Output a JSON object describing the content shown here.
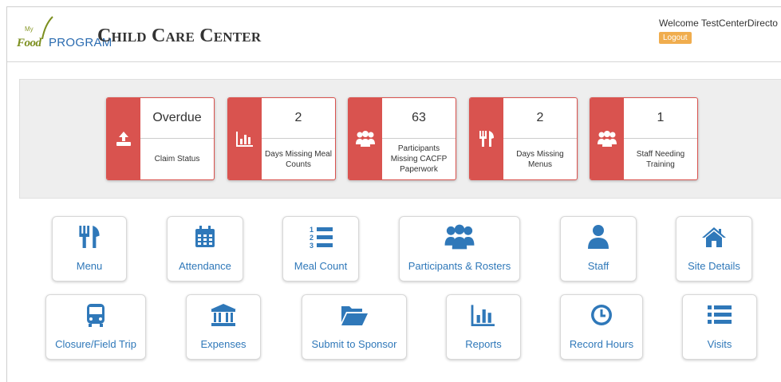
{
  "header": {
    "logo_my": "My",
    "logo_food": "Food",
    "logo_program": "PROGRAM",
    "title": "Child Care Center",
    "welcome": "Welcome TestCenterDirecto",
    "logout_label": "Logout"
  },
  "stats": [
    {
      "value": "Overdue",
      "label": "Claim Status",
      "icon": "upload-icon"
    },
    {
      "value": "2",
      "label": "Days Missing Meal Counts",
      "icon": "bar-chart-icon"
    },
    {
      "value": "63",
      "label": "Participants Missing CACFP Paperwork",
      "icon": "users-icon"
    },
    {
      "value": "2",
      "label": "Days Missing Menus",
      "icon": "fork-knife-icon"
    },
    {
      "value": "1",
      "label": "Staff Needing Training",
      "icon": "users-icon"
    }
  ],
  "tiles": [
    {
      "label": "Menu",
      "icon": "fork-knife-icon"
    },
    {
      "label": "Attendance",
      "icon": "calendar-icon"
    },
    {
      "label": "Meal Count",
      "icon": "numbered-list-icon"
    },
    {
      "label": "Participants & Rosters",
      "icon": "users-icon"
    },
    {
      "label": "Staff",
      "icon": "user-icon"
    },
    {
      "label": "Site Details",
      "icon": "home-icon"
    },
    {
      "label": "Closure/Field Trip",
      "icon": "bus-icon"
    },
    {
      "label": "Expenses",
      "icon": "bank-icon"
    },
    {
      "label": "Submit to Sponsor",
      "icon": "folder-open-icon"
    },
    {
      "label": "Reports",
      "icon": "bar-chart-icon"
    },
    {
      "label": "Record Hours",
      "icon": "clock-icon"
    },
    {
      "label": "Visits",
      "icon": "list-icon"
    }
  ],
  "colors": {
    "alert_red": "#d9534f",
    "tile_blue": "#2f78b9",
    "logout_orange": "#f0ad4e"
  }
}
